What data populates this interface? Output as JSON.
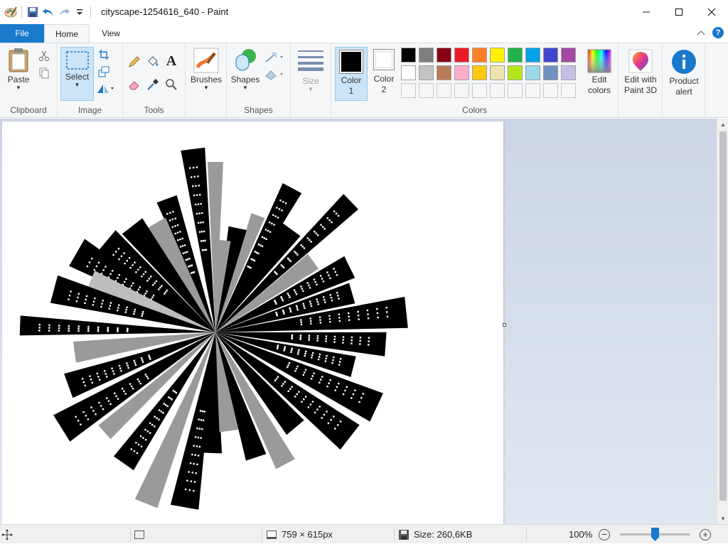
{
  "titlebar": {
    "title": "cityscape-1254616_640 - Paint"
  },
  "tabs": {
    "file": "File",
    "home": "Home",
    "view": "View"
  },
  "ribbon": {
    "clipboard": {
      "paste": "Paste",
      "group": "Clipboard"
    },
    "image": {
      "select": "Select",
      "group": "Image"
    },
    "tools": {
      "group": "Tools"
    },
    "brushes": "Brushes",
    "shapes": {
      "button": "Shapes",
      "group": "Shapes"
    },
    "size": "Size",
    "color1": {
      "line1": "Color",
      "line2": "1"
    },
    "color2": {
      "line1": "Color",
      "line2": "2"
    },
    "colors_group": "Colors",
    "edit_colors": {
      "line1": "Edit",
      "line2": "colors"
    },
    "paint3d": {
      "line1": "Edit with",
      "line2": "Paint 3D"
    },
    "product_alert": {
      "line1": "Product",
      "line2": "alert"
    }
  },
  "palette": {
    "row1": [
      "#000000",
      "#7f7f7f",
      "#880015",
      "#ed1c24",
      "#ff7f27",
      "#fff200",
      "#22b14c",
      "#00a2e8",
      "#3f48cc",
      "#a349a4"
    ],
    "row2": [
      "#ffffff",
      "#c3c3c3",
      "#b97a57",
      "#ffaec9",
      "#ffc90e",
      "#efe4b0",
      "#b5e61d",
      "#99d9ea",
      "#7092be",
      "#c8bfe7"
    ],
    "row3_empty": 10,
    "color1": "#000000",
    "color2": "#ffffff"
  },
  "status": {
    "dimensions": "759 × 615px",
    "size": "Size: 260,6KB",
    "zoom": "100%"
  }
}
